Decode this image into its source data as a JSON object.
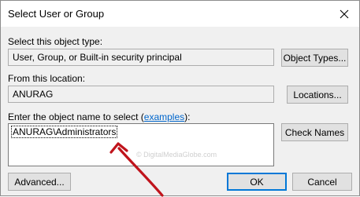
{
  "dialog": {
    "title": "Select User or Group",
    "close_icon": "close-icon"
  },
  "object_type": {
    "label": "Select this object type:",
    "value": "User, Group, or Built-in security principal",
    "button_label": "Object Types..."
  },
  "location": {
    "label": "From this location:",
    "value": "ANURAG",
    "button_label": "Locations..."
  },
  "object_name": {
    "label_prefix": "Enter the object name to select (",
    "examples_link": "examples",
    "label_suffix": "):",
    "value": "ANURAG\\Administrators",
    "check_names_label": "Check Names"
  },
  "footer": {
    "advanced_label": "Advanced...",
    "ok_label": "OK",
    "cancel_label": "Cancel"
  },
  "watermark": "© DigitalMediaGlobe.com",
  "annotation": {
    "arrow_color": "#c0141c"
  }
}
